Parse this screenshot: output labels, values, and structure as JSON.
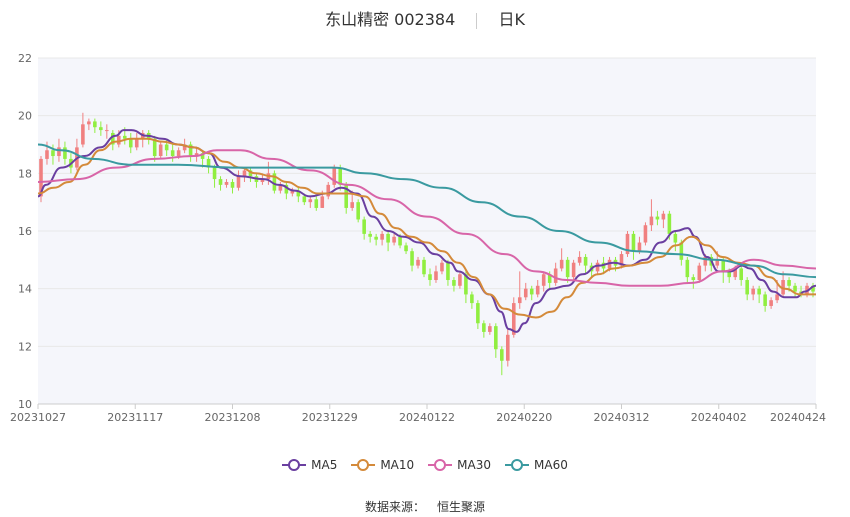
{
  "header": {
    "stock_name": "东山精密",
    "stock_code": "002384",
    "period": "日K"
  },
  "source": {
    "label": "数据来源：",
    "value": "恒生聚源"
  },
  "colors": {
    "up": "#f08080",
    "down": "#90ee40",
    "grid": "#e8e8e8",
    "plot_bg": "#f5f6fb",
    "axis_text": "#666666"
  },
  "chart_data": {
    "type": "candlestick",
    "y_ticks": [
      "10",
      "12",
      "14",
      "16",
      "18",
      "20",
      "22"
    ],
    "ylim": [
      10,
      22
    ],
    "x_ticks": [
      "20231027",
      "20231117",
      "20231208",
      "20231229",
      "20240122",
      "20240220",
      "20240312",
      "20240402",
      "20240424"
    ],
    "grid": true,
    "legend_position": "bottom",
    "candles": [
      [
        17.2,
        18.5,
        18.6,
        17.0
      ],
      [
        18.5,
        18.8,
        19.1,
        18.3
      ],
      [
        18.8,
        18.6,
        19.0,
        18.3
      ],
      [
        18.6,
        18.9,
        19.2,
        18.4
      ],
      [
        18.9,
        18.5,
        19.1,
        18.3
      ],
      [
        18.5,
        18.2,
        18.7,
        18.0
      ],
      [
        18.2,
        18.9,
        19.2,
        18.1
      ],
      [
        19.0,
        19.7,
        20.1,
        18.9
      ],
      [
        19.7,
        19.8,
        19.9,
        19.5
      ],
      [
        19.8,
        19.6,
        19.9,
        19.4
      ],
      [
        19.6,
        19.5,
        19.8,
        19.3
      ],
      [
        19.5,
        19.5,
        19.7,
        19.2
      ],
      [
        19.4,
        19.0,
        19.5,
        18.8
      ],
      [
        19.0,
        19.3,
        19.5,
        18.9
      ],
      [
        19.3,
        19.2,
        19.6,
        19.0
      ],
      [
        19.2,
        18.9,
        19.4,
        18.7
      ],
      [
        18.9,
        19.2,
        19.4,
        18.8
      ],
      [
        19.2,
        19.4,
        19.5,
        18.9
      ],
      [
        19.4,
        19.2,
        19.5,
        19.0
      ],
      [
        19.2,
        18.6,
        19.3,
        18.4
      ],
      [
        18.6,
        19.0,
        19.1,
        18.5
      ],
      [
        19.0,
        18.8,
        19.2,
        18.6
      ],
      [
        18.8,
        18.6,
        19.0,
        18.4
      ],
      [
        18.6,
        18.8,
        18.9,
        18.5
      ],
      [
        18.8,
        19.0,
        19.2,
        18.7
      ],
      [
        19.0,
        18.6,
        19.1,
        18.4
      ],
      [
        18.6,
        18.7,
        18.9,
        18.4
      ],
      [
        18.7,
        18.5,
        18.8,
        18.2
      ],
      [
        18.5,
        18.2,
        18.6,
        18.0
      ],
      [
        18.2,
        17.8,
        18.3,
        17.5
      ],
      [
        17.8,
        17.6,
        17.9,
        17.4
      ],
      [
        17.6,
        17.7,
        17.8,
        17.5
      ],
      [
        17.7,
        17.5,
        17.8,
        17.3
      ],
      [
        17.5,
        17.9,
        18.1,
        17.4
      ],
      [
        17.9,
        18.1,
        18.2,
        17.7
      ],
      [
        18.1,
        17.9,
        18.2,
        17.7
      ],
      [
        17.9,
        17.7,
        18.0,
        17.5
      ],
      [
        17.7,
        17.8,
        18.0,
        17.6
      ],
      [
        17.8,
        18.0,
        18.4,
        17.6
      ],
      [
        18.0,
        17.4,
        18.1,
        17.3
      ],
      [
        17.4,
        17.6,
        17.7,
        17.3
      ],
      [
        17.6,
        17.3,
        17.7,
        17.1
      ],
      [
        17.3,
        17.4,
        17.5,
        17.2
      ],
      [
        17.4,
        17.2,
        17.5,
        17.0
      ],
      [
        17.2,
        17.0,
        17.3,
        16.9
      ],
      [
        17.0,
        17.1,
        17.2,
        16.8
      ],
      [
        17.1,
        16.8,
        17.2,
        16.7
      ],
      [
        16.8,
        17.2,
        17.4,
        16.8
      ],
      [
        17.2,
        17.6,
        17.7,
        17.1
      ],
      [
        17.6,
        18.2,
        18.3,
        17.5
      ],
      [
        18.2,
        17.6,
        18.3,
        17.4
      ],
      [
        17.6,
        16.8,
        17.7,
        16.6
      ],
      [
        16.8,
        17.0,
        17.4,
        16.7
      ],
      [
        17.0,
        16.4,
        17.1,
        16.3
      ],
      [
        16.4,
        15.9,
        16.5,
        15.7
      ],
      [
        15.9,
        15.8,
        16.0,
        15.6
      ],
      [
        15.8,
        15.7,
        15.9,
        15.5
      ],
      [
        15.7,
        15.9,
        16.0,
        15.5
      ],
      [
        15.9,
        15.6,
        16.0,
        15.3
      ],
      [
        15.6,
        15.8,
        15.9,
        15.5
      ],
      [
        15.8,
        15.5,
        15.9,
        15.4
      ],
      [
        15.5,
        15.3,
        15.6,
        15.2
      ],
      [
        15.3,
        14.8,
        15.4,
        14.6
      ],
      [
        14.8,
        15.0,
        15.1,
        14.7
      ],
      [
        15.0,
        14.5,
        15.1,
        14.4
      ],
      [
        14.5,
        14.3,
        14.7,
        14.1
      ],
      [
        14.3,
        14.6,
        14.8,
        14.2
      ],
      [
        14.6,
        14.9,
        15.0,
        14.5
      ],
      [
        14.9,
        14.3,
        15.0,
        14.1
      ],
      [
        14.3,
        14.1,
        14.4,
        13.9
      ],
      [
        14.1,
        14.5,
        14.6,
        14.0
      ],
      [
        14.5,
        13.8,
        14.6,
        13.5
      ],
      [
        13.8,
        13.5,
        13.9,
        13.3
      ],
      [
        13.5,
        12.8,
        13.6,
        12.6
      ],
      [
        12.8,
        12.5,
        12.9,
        12.3
      ],
      [
        12.5,
        12.7,
        12.8,
        12.4
      ],
      [
        12.7,
        11.9,
        12.8,
        11.6
      ],
      [
        11.9,
        11.5,
        12.0,
        11.0
      ],
      [
        11.5,
        12.4,
        12.6,
        11.3
      ],
      [
        12.4,
        13.5,
        13.7,
        12.3
      ],
      [
        13.5,
        13.7,
        14.6,
        13.3
      ],
      [
        13.7,
        14.0,
        14.2,
        13.6
      ],
      [
        14.0,
        13.8,
        14.1,
        13.6
      ],
      [
        13.8,
        14.1,
        14.3,
        13.7
      ],
      [
        14.1,
        14.5,
        14.6,
        13.9
      ],
      [
        14.5,
        14.2,
        14.6,
        14.0
      ],
      [
        14.2,
        14.7,
        14.9,
        14.1
      ],
      [
        14.7,
        15.0,
        15.4,
        14.6
      ],
      [
        15.0,
        14.4,
        15.1,
        14.2
      ],
      [
        14.4,
        14.9,
        15.0,
        14.3
      ],
      [
        14.9,
        15.1,
        15.3,
        14.8
      ],
      [
        15.1,
        14.8,
        15.2,
        14.5
      ],
      [
        14.8,
        14.6,
        14.9,
        14.4
      ],
      [
        14.6,
        14.9,
        15.0,
        14.5
      ],
      [
        14.9,
        14.7,
        15.1,
        14.5
      ],
      [
        14.7,
        15.0,
        15.1,
        14.6
      ],
      [
        15.0,
        14.8,
        15.1,
        14.6
      ],
      [
        14.8,
        15.2,
        15.3,
        14.7
      ],
      [
        15.2,
        15.9,
        16.0,
        15.1
      ],
      [
        15.9,
        15.3,
        16.0,
        15.0
      ],
      [
        15.3,
        15.6,
        15.8,
        15.2
      ],
      [
        15.6,
        16.2,
        16.3,
        15.5
      ],
      [
        16.2,
        16.5,
        17.1,
        16.0
      ],
      [
        16.5,
        16.4,
        16.7,
        16.2
      ],
      [
        16.4,
        16.6,
        16.7,
        16.1
      ],
      [
        16.6,
        15.9,
        16.7,
        15.7
      ],
      [
        15.9,
        15.6,
        16.0,
        15.3
      ],
      [
        15.6,
        15.0,
        15.7,
        14.8
      ],
      [
        15.0,
        14.4,
        15.1,
        14.2
      ],
      [
        14.4,
        14.3,
        14.5,
        14.0
      ],
      [
        14.3,
        14.8,
        14.9,
        14.2
      ],
      [
        14.8,
        15.1,
        15.2,
        14.6
      ],
      [
        15.1,
        14.8,
        15.2,
        14.6
      ],
      [
        14.8,
        15.0,
        15.3,
        14.7
      ],
      [
        15.0,
        14.6,
        15.1,
        14.2
      ],
      [
        14.6,
        14.4,
        14.7,
        14.2
      ],
      [
        14.4,
        14.7,
        14.8,
        14.3
      ],
      [
        14.7,
        14.3,
        14.8,
        14.1
      ],
      [
        14.3,
        13.8,
        14.4,
        13.6
      ],
      [
        13.8,
        14.0,
        14.1,
        13.6
      ],
      [
        14.0,
        13.8,
        14.1,
        13.5
      ],
      [
        13.8,
        13.4,
        13.9,
        13.2
      ],
      [
        13.4,
        13.6,
        13.7,
        13.3
      ],
      [
        13.6,
        13.8,
        14.3,
        13.5
      ],
      [
        13.8,
        14.3,
        14.6,
        13.7
      ],
      [
        14.3,
        14.1,
        14.4,
        13.9
      ],
      [
        14.1,
        13.9,
        14.2,
        13.7
      ],
      [
        13.9,
        13.8,
        14.1,
        13.7
      ],
      [
        13.8,
        14.1,
        14.2,
        13.7
      ],
      [
        14.1,
        13.9,
        14.2,
        13.7
      ]
    ],
    "series": [
      {
        "name": "MA5",
        "color": "#6a3fa0",
        "values": [
          [
            0,
            17.2
          ],
          [
            0.01,
            17.6
          ],
          [
            0.03,
            18.2
          ],
          [
            0.06,
            18.6
          ],
          [
            0.08,
            18.9
          ],
          [
            0.1,
            19.3
          ],
          [
            0.11,
            19.5
          ],
          [
            0.12,
            19.5
          ],
          [
            0.14,
            19.3
          ],
          [
            0.16,
            19.2
          ],
          [
            0.18,
            19.0
          ],
          [
            0.2,
            18.9
          ],
          [
            0.22,
            18.7
          ],
          [
            0.235,
            18.2
          ],
          [
            0.26,
            17.9
          ],
          [
            0.29,
            17.8
          ],
          [
            0.31,
            17.6
          ],
          [
            0.33,
            17.4
          ],
          [
            0.35,
            17.2
          ],
          [
            0.37,
            17.3
          ],
          [
            0.39,
            17.5
          ],
          [
            0.41,
            17.3
          ],
          [
            0.43,
            16.5
          ],
          [
            0.45,
            16.0
          ],
          [
            0.47,
            15.8
          ],
          [
            0.49,
            15.6
          ],
          [
            0.51,
            15.2
          ],
          [
            0.53,
            14.9
          ],
          [
            0.54,
            14.6
          ],
          [
            0.56,
            14.3
          ],
          [
            0.58,
            13.8
          ],
          [
            0.595,
            13.2
          ],
          [
            0.605,
            12.6
          ],
          [
            0.615,
            12.5
          ],
          [
            0.625,
            12.8
          ],
          [
            0.64,
            13.5
          ],
          [
            0.66,
            14.0
          ],
          [
            0.68,
            14.1
          ],
          [
            0.7,
            14.5
          ],
          [
            0.72,
            14.8
          ],
          [
            0.74,
            14.9
          ],
          [
            0.76,
            14.8
          ],
          [
            0.78,
            15.0
          ],
          [
            0.8,
            15.6
          ],
          [
            0.82,
            16.0
          ],
          [
            0.835,
            16.1
          ],
          [
            0.845,
            15.8
          ],
          [
            0.86,
            15.1
          ],
          [
            0.875,
            14.6
          ],
          [
            0.89,
            14.6
          ],
          [
            0.905,
            14.8
          ],
          [
            0.915,
            14.7
          ],
          [
            0.93,
            14.3
          ],
          [
            0.945,
            13.9
          ],
          [
            0.96,
            13.7
          ],
          [
            0.975,
            13.7
          ],
          [
            0.985,
            13.9
          ],
          [
            1.0,
            14.1
          ]
        ]
      },
      {
        "name": "MA10",
        "color": "#d48a3a",
        "values": [
          [
            0,
            17.3
          ],
          [
            0.02,
            17.5
          ],
          [
            0.04,
            17.7
          ],
          [
            0.06,
            18.3
          ],
          [
            0.08,
            18.8
          ],
          [
            0.1,
            19.1
          ],
          [
            0.12,
            19.2
          ],
          [
            0.14,
            19.2
          ],
          [
            0.16,
            19.1
          ],
          [
            0.18,
            19.0
          ],
          [
            0.2,
            18.9
          ],
          [
            0.22,
            18.7
          ],
          [
            0.24,
            18.4
          ],
          [
            0.26,
            18.2
          ],
          [
            0.28,
            18.0
          ],
          [
            0.3,
            17.9
          ],
          [
            0.32,
            17.7
          ],
          [
            0.34,
            17.5
          ],
          [
            0.36,
            17.3
          ],
          [
            0.38,
            17.3
          ],
          [
            0.4,
            17.3
          ],
          [
            0.42,
            17.2
          ],
          [
            0.44,
            16.6
          ],
          [
            0.46,
            16.1
          ],
          [
            0.48,
            15.8
          ],
          [
            0.5,
            15.6
          ],
          [
            0.52,
            15.3
          ],
          [
            0.54,
            14.9
          ],
          [
            0.56,
            14.4
          ],
          [
            0.58,
            13.8
          ],
          [
            0.6,
            13.3
          ],
          [
            0.62,
            13.1
          ],
          [
            0.64,
            13.0
          ],
          [
            0.66,
            13.2
          ],
          [
            0.68,
            13.7
          ],
          [
            0.7,
            14.2
          ],
          [
            0.72,
            14.5
          ],
          [
            0.74,
            14.7
          ],
          [
            0.76,
            14.8
          ],
          [
            0.78,
            14.9
          ],
          [
            0.8,
            15.1
          ],
          [
            0.82,
            15.5
          ],
          [
            0.84,
            15.8
          ],
          [
            0.86,
            15.5
          ],
          [
            0.88,
            15.1
          ],
          [
            0.9,
            14.9
          ],
          [
            0.92,
            14.8
          ],
          [
            0.94,
            14.4
          ],
          [
            0.96,
            14.0
          ],
          [
            0.98,
            13.8
          ],
          [
            1.0,
            13.8
          ]
        ]
      },
      {
        "name": "MA30",
        "color": "#d865a8",
        "values": [
          [
            0,
            17.7
          ],
          [
            0.05,
            17.8
          ],
          [
            0.1,
            18.2
          ],
          [
            0.15,
            18.5
          ],
          [
            0.2,
            18.6
          ],
          [
            0.23,
            18.8
          ],
          [
            0.26,
            18.8
          ],
          [
            0.3,
            18.5
          ],
          [
            0.35,
            18.1
          ],
          [
            0.4,
            17.6
          ],
          [
            0.45,
            17.1
          ],
          [
            0.5,
            16.5
          ],
          [
            0.55,
            15.9
          ],
          [
            0.6,
            15.2
          ],
          [
            0.64,
            14.6
          ],
          [
            0.68,
            14.3
          ],
          [
            0.72,
            14.2
          ],
          [
            0.76,
            14.1
          ],
          [
            0.8,
            14.1
          ],
          [
            0.84,
            14.2
          ],
          [
            0.88,
            14.6
          ],
          [
            0.92,
            15.0
          ],
          [
            0.96,
            14.8
          ],
          [
            1.0,
            14.7
          ]
        ]
      },
      {
        "name": "MA60",
        "color": "#3a9aa0",
        "values": [
          [
            0,
            19.0
          ],
          [
            0.03,
            18.8
          ],
          [
            0.07,
            18.5
          ],
          [
            0.12,
            18.3
          ],
          [
            0.18,
            18.3
          ],
          [
            0.25,
            18.2
          ],
          [
            0.32,
            18.2
          ],
          [
            0.38,
            18.2
          ],
          [
            0.42,
            18.0
          ],
          [
            0.47,
            17.8
          ],
          [
            0.52,
            17.5
          ],
          [
            0.57,
            17.0
          ],
          [
            0.62,
            16.5
          ],
          [
            0.67,
            16.0
          ],
          [
            0.72,
            15.6
          ],
          [
            0.77,
            15.3
          ],
          [
            0.82,
            15.2
          ],
          [
            0.87,
            15.0
          ],
          [
            0.92,
            14.8
          ],
          [
            0.96,
            14.5
          ],
          [
            1.0,
            14.4
          ]
        ]
      }
    ]
  }
}
